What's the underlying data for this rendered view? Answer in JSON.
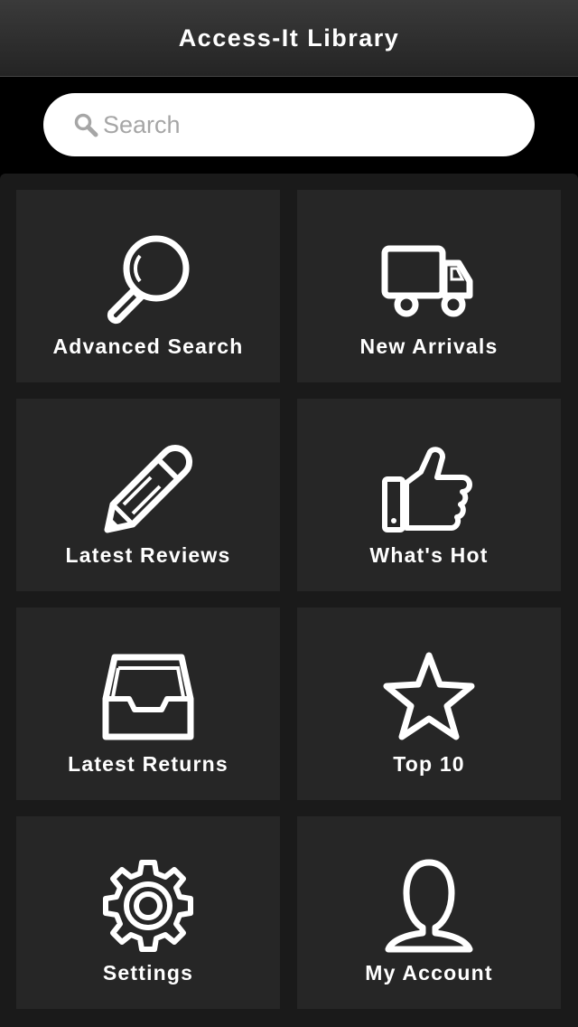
{
  "header": {
    "title": "Access-It Library"
  },
  "search": {
    "placeholder": "Search",
    "value": "",
    "icon": "search-icon"
  },
  "tiles": [
    {
      "label": "Advanced Search",
      "icon": "magnifier-icon"
    },
    {
      "label": "New Arrivals",
      "icon": "truck-icon"
    },
    {
      "label": "Latest Reviews",
      "icon": "pencil-icon"
    },
    {
      "label": "What's Hot",
      "icon": "thumbs-up-icon"
    },
    {
      "label": "Latest Returns",
      "icon": "inbox-tray-icon"
    },
    {
      "label": "Top 10",
      "icon": "star-icon"
    },
    {
      "label": "Settings",
      "icon": "gear-icon"
    },
    {
      "label": "My Account",
      "icon": "user-icon"
    }
  ],
  "colors": {
    "background": "#000000",
    "header": "#2e2e2e",
    "panel": "#1a1a1a",
    "tile": "#262626",
    "text": "#ffffff",
    "search_field": "#ffffff",
    "placeholder": "#a6a6a6"
  }
}
